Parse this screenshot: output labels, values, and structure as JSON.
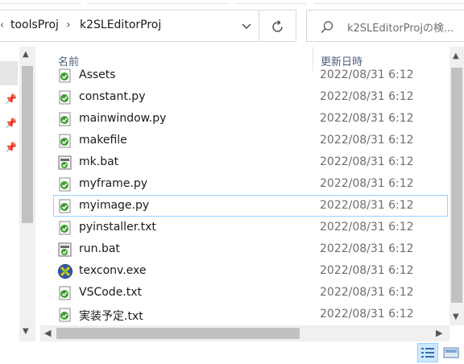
{
  "address_bar": {
    "breadcrumb": [
      "toolsProj",
      "k2SLEditorProj"
    ]
  },
  "search": {
    "placeholder": "k2SLEditorProjの検..."
  },
  "columns": {
    "name": "名前",
    "date_modified": "更新日時"
  },
  "files": [
    {
      "name": "Assets",
      "date": "2022/08/31 6:12",
      "icon": "python-file-icon"
    },
    {
      "name": "constant.py",
      "date": "2022/08/31 6:12",
      "icon": "python-file-icon"
    },
    {
      "name": "mainwindow.py",
      "date": "2022/08/31 6:12",
      "icon": "python-file-icon"
    },
    {
      "name": "makefile",
      "date": "2022/08/31 6:12",
      "icon": "text-file-icon"
    },
    {
      "name": "mk.bat",
      "date": "2022/08/31 6:12",
      "icon": "batch-file-icon"
    },
    {
      "name": "myframe.py",
      "date": "2022/08/31 6:12",
      "icon": "python-file-icon"
    },
    {
      "name": "myimage.py",
      "date": "2022/08/31 6:12",
      "icon": "python-file-icon"
    },
    {
      "name": "pyinstaller.txt",
      "date": "2022/08/31 6:12",
      "icon": "text-file-icon"
    },
    {
      "name": "run.bat",
      "date": "2022/08/31 6:12",
      "icon": "batch-file-icon"
    },
    {
      "name": "texconv.exe",
      "date": "2022/08/31 6:12",
      "icon": "exe-file-icon"
    },
    {
      "name": "VSCode.txt",
      "date": "2022/08/31 6:12",
      "icon": "text-file-icon"
    },
    {
      "name": "実装予定.txt",
      "date": "2022/08/31 6:12",
      "icon": "text-file-icon"
    }
  ],
  "colors": {
    "selection_border": "#99d1ff",
    "header_text": "#4c607a",
    "date_text": "#6d6d6d"
  }
}
